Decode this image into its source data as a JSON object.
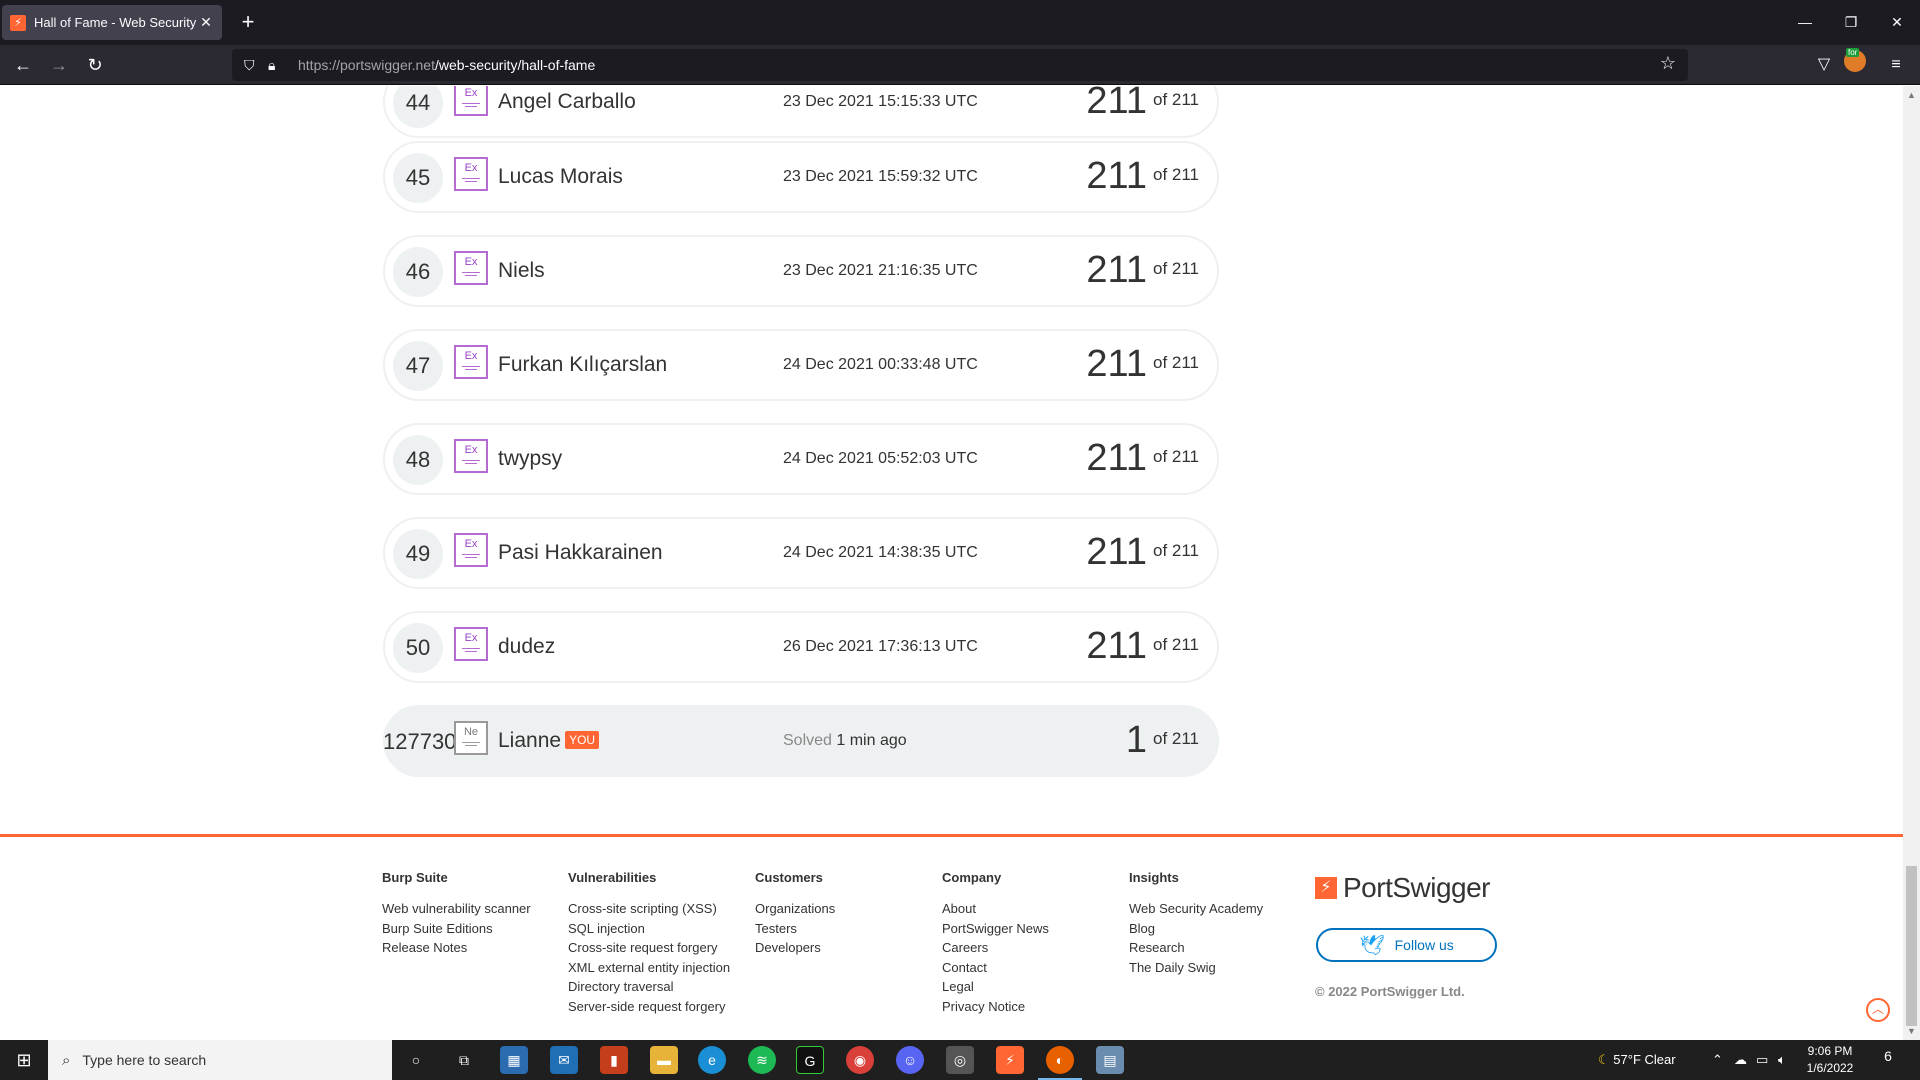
{
  "browser": {
    "tab_title": "Hall of Fame - Web Security Ac",
    "tab_favicon": "portswigger-favicon",
    "new_tab_label": "+",
    "url_host": "https://portswigger.net",
    "url_path": "/web-security/hall-of-fame"
  },
  "leaderboard": {
    "rows": [
      {
        "rank": "44",
        "badge": "Ex",
        "name": "Angel Carballo",
        "date": "23 Dec 2021 15:15:33 UTC",
        "score": "211",
        "of": "of 211"
      },
      {
        "rank": "45",
        "badge": "Ex",
        "name": "Lucas Morais",
        "date": "23 Dec 2021 15:59:32 UTC",
        "score": "211",
        "of": "of 211"
      },
      {
        "rank": "46",
        "badge": "Ex",
        "name": "Niels",
        "date": "23 Dec 2021 21:16:35 UTC",
        "score": "211",
        "of": "of 211"
      },
      {
        "rank": "47",
        "badge": "Ex",
        "name": "Furkan Kılıçarslan",
        "date": "24 Dec 2021 00:33:48 UTC",
        "score": "211",
        "of": "of 211"
      },
      {
        "rank": "48",
        "badge": "Ex",
        "name": "twypsy",
        "date": "24 Dec 2021 05:52:03 UTC",
        "score": "211",
        "of": "of 211"
      },
      {
        "rank": "49",
        "badge": "Ex",
        "name": "Pasi Hakkarainen",
        "date": "24 Dec 2021 14:38:35 UTC",
        "score": "211",
        "of": "of 211"
      },
      {
        "rank": "50",
        "badge": "Ex",
        "name": "dudez",
        "date": "26 Dec 2021 17:36:13 UTC",
        "score": "211",
        "of": "of 211"
      }
    ],
    "me": {
      "rank": "127730",
      "badge": "Ne",
      "name": "Lianne",
      "you": "YOU",
      "solved_label": "Solved",
      "solved_time": "1 min ago",
      "score": "1",
      "of": "of 211"
    }
  },
  "footer": {
    "columns": [
      {
        "title": "Burp Suite",
        "links": [
          "Web vulnerability scanner",
          "Burp Suite Editions",
          "Release Notes"
        ]
      },
      {
        "title": "Vulnerabilities",
        "links": [
          "Cross-site scripting (XSS)",
          "SQL injection",
          "Cross-site request forgery",
          "XML external entity injection",
          "Directory traversal",
          "Server-side request forgery"
        ]
      },
      {
        "title": "Customers",
        "links": [
          "Organizations",
          "Testers",
          "Developers"
        ]
      },
      {
        "title": "Company",
        "links": [
          "About",
          "PortSwigger News",
          "Careers",
          "Contact",
          "Legal",
          "Privacy Notice"
        ]
      },
      {
        "title": "Insights",
        "links": [
          "Web Security Academy",
          "Blog",
          "Research",
          "The Daily Swig"
        ]
      }
    ],
    "brand": "PortSwigger",
    "follow_label": "Follow us",
    "copyright": "© 2022 PortSwigger Ltd."
  },
  "taskbar": {
    "search_placeholder": "Type here to search",
    "weather": "57°F  Clear",
    "time": "9:06 PM",
    "date": "1/6/2022",
    "notification_count": "6",
    "brand_color": "#ff6633",
    "badge_expert_color": "#b66ad4"
  }
}
